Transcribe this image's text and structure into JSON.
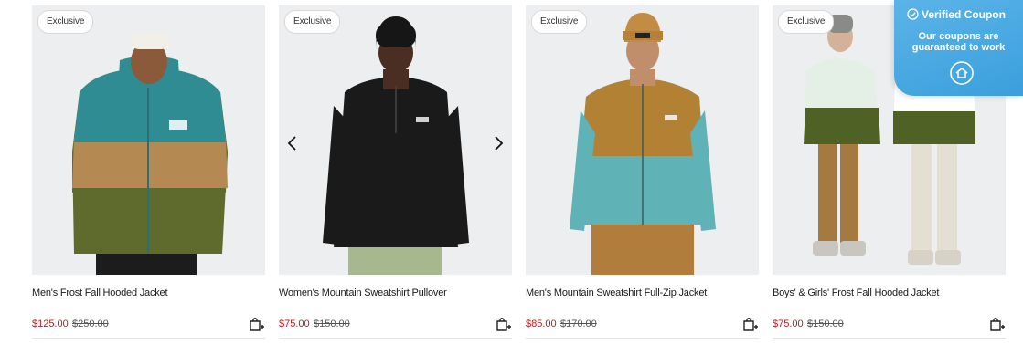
{
  "products": [
    {
      "badge": "Exclusive",
      "title": "Men's Frost Fall Hooded Jacket",
      "price": "$125.00",
      "original_price": "$250.00",
      "colors": {
        "bg": "#eceeef",
        "top": "#2f8c93",
        "mid": "#b58a52",
        "bottom": "#5e6b2d",
        "hat": "#f2efe9",
        "skin": "#8a5a3b"
      }
    },
    {
      "badge": "Exclusive",
      "title": "Women's Mountain Sweatshirt Pullover",
      "price": "$75.00",
      "original_price": "$150.00",
      "colors": {
        "bg": "#eceeef",
        "top": "#1a1a1a",
        "pants": "#a8b88e",
        "hat": "#161616",
        "skin": "#4a2e22"
      }
    },
    {
      "badge": "Exclusive",
      "title": "Men's Mountain Sweatshirt Full-Zip Jacket",
      "price": "$85.00",
      "original_price": "$170.00",
      "colors": {
        "bg": "#eceeef",
        "top": "#b38133",
        "bottom": "#5fb2b5",
        "pants": "#b07d3c",
        "hat": "#c28c45",
        "skin": "#c08e6b"
      }
    },
    {
      "badge": "Exclusive",
      "title": "Boys' & Girls' Frost Fall Hooded Jacket",
      "price": "$75.00",
      "original_price": "$150.00",
      "colors": {
        "bg": "#eceeef",
        "top": "#e4efe6",
        "mid": "#4f6124",
        "pants": "#a47a3f",
        "pants2": "#e3dfd2",
        "hat": "#8a8a86",
        "skin": "#d4b29a"
      }
    }
  ],
  "carousel": {
    "prev_icon": "chevron-left-icon",
    "next_icon": "chevron-right-icon"
  },
  "coupon": {
    "title": "Verified Coupon",
    "subtitle": "Our coupons are guaranteed to work",
    "icon": "check-circle-icon",
    "logo": "house-logo-icon",
    "color": "#4aa9e2"
  }
}
